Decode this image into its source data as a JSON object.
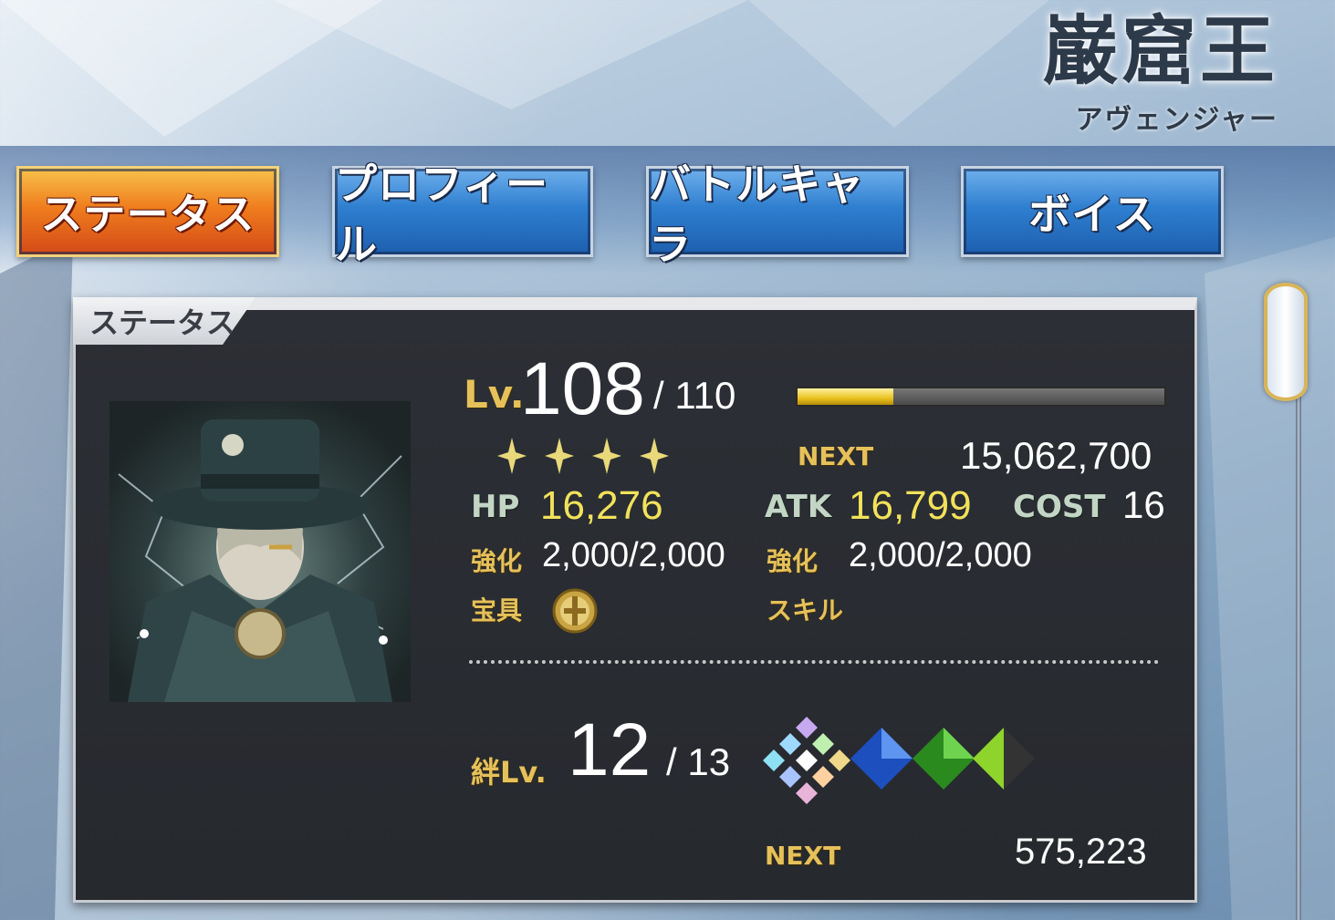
{
  "header": {
    "servant_name": "巌窟王",
    "servant_class": "アヴェンジャー"
  },
  "tabs": [
    {
      "label": "ステータス",
      "active": true
    },
    {
      "label": "プロフィール",
      "active": false
    },
    {
      "label": "バトルキャラ",
      "active": false
    },
    {
      "label": "ボイス",
      "active": false
    }
  ],
  "panel": {
    "title": "ステータス",
    "level": {
      "prefix": "Lv.",
      "current": "108",
      "max": "/ 110",
      "exp_progress_fraction": 0.26,
      "next_label": "NEXT",
      "next_value": "15,062,700"
    },
    "rarity_stars": 4,
    "stats": {
      "hp_label": "HP",
      "hp_value": "16,276",
      "atk_label": "ATK",
      "atk_value": "16,799",
      "cost_label": "COST",
      "cost_value": "16",
      "hp_enhance_label": "強化",
      "hp_enhance_value": "2,000/2,000",
      "atk_enhance_label": "強化",
      "atk_enhance_value": "2,000/2,000",
      "np_label": "宝具",
      "skill_label": "スキル"
    },
    "bond": {
      "prefix": "絆Lv.",
      "current": "12",
      "max": "/ 13",
      "next_label": "NEXT",
      "next_value": "575,223"
    }
  },
  "colors": {
    "accent_gold": "#e6c15a",
    "value_yellow": "#f2e25a",
    "tab_active": "#ef7d1e",
    "tab_blue": "#2f7fd0",
    "panel_bg": "#2c2f35"
  }
}
